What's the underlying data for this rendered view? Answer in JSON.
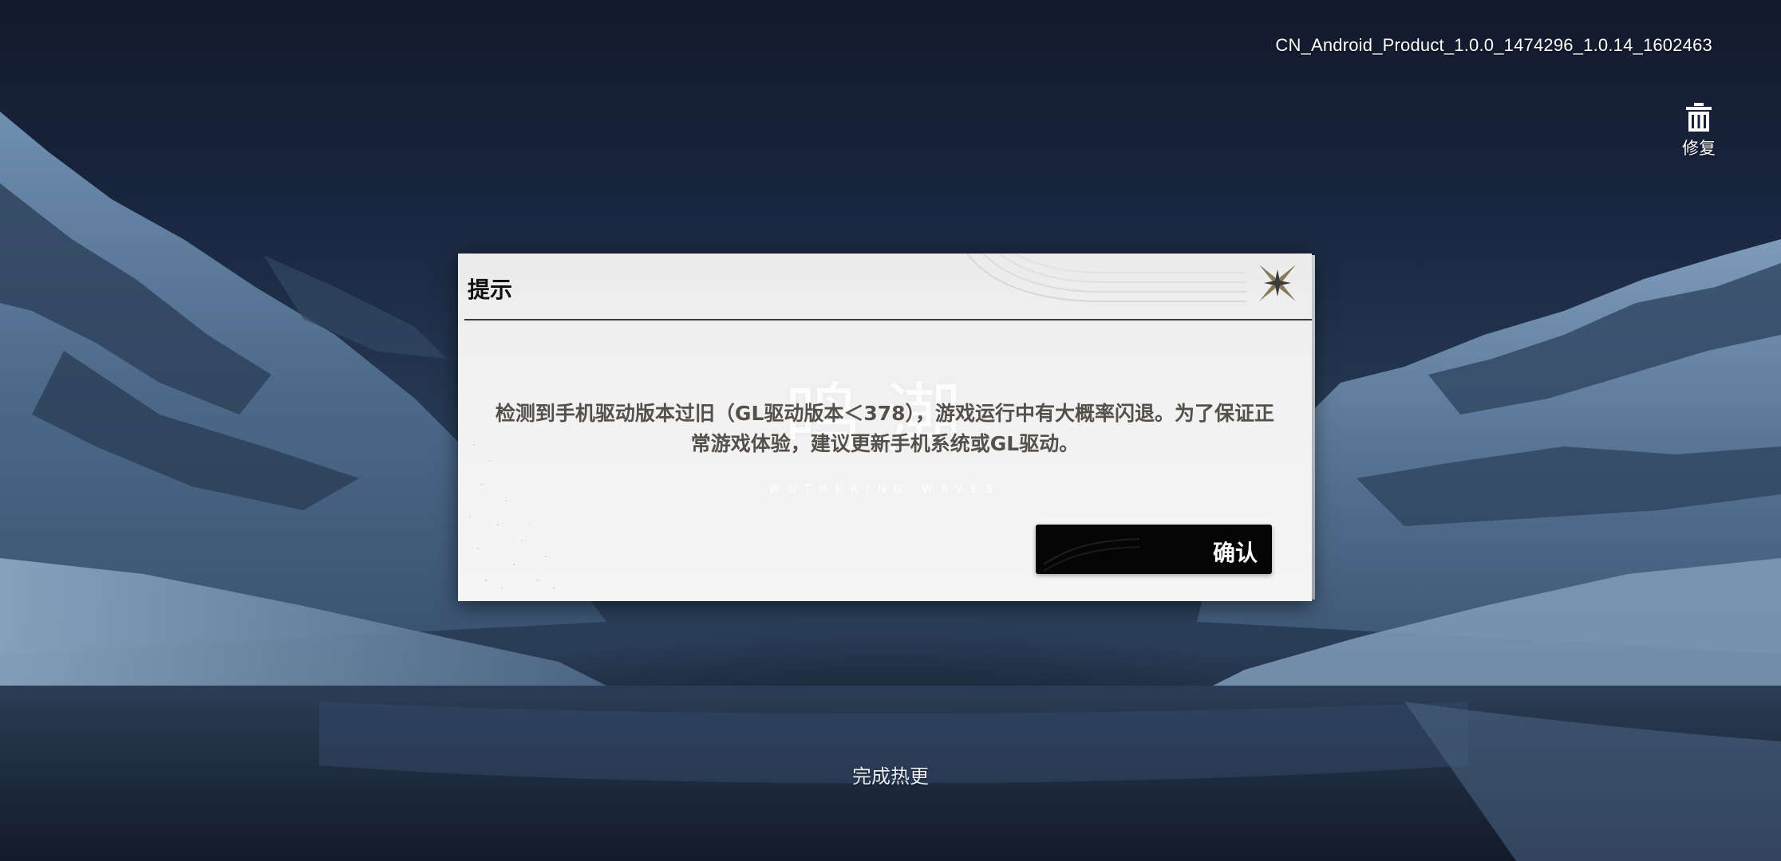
{
  "version_string": "CN_Android_Product_1.0.0_1474296_1.0.14_1602463",
  "repair": {
    "label": "修复",
    "icon": "trash-icon"
  },
  "dialog": {
    "title": "提示",
    "close_icon": "close-x-icon",
    "message": "检测到手机驱动版本过旧（GL驱动版本＜378），游戏运行中有大概率闪退。为了保证正常游戏体验，建议更新手机系统或GL驱动。",
    "confirm_label": "确认",
    "watermark": "鸣潮",
    "watermark_sub": "WUTHERING WAVES"
  },
  "status_text": "完成热更",
  "colors": {
    "dialog_bg": "#f3f3f3",
    "confirm_bg": "#050505",
    "close_accent": "#8a7a58",
    "message_text": "#555049"
  }
}
